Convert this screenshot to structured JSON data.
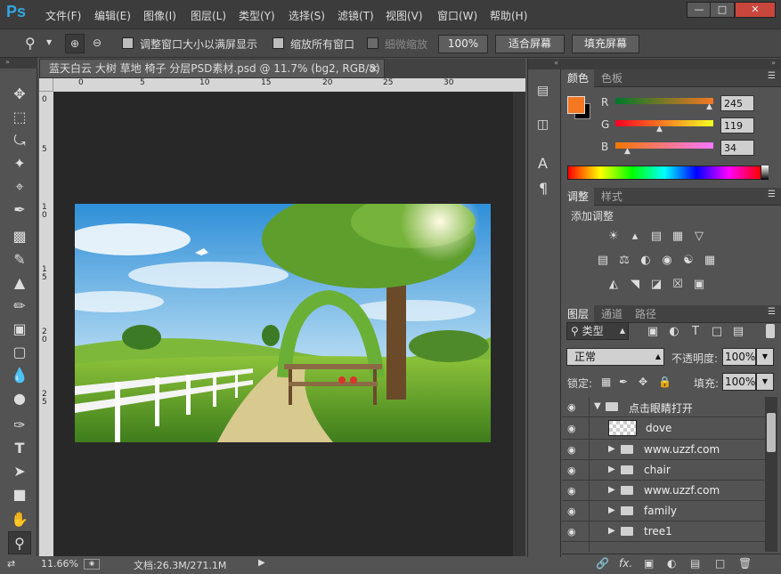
{
  "menubar": {
    "logo": "Ps",
    "items": [
      "文件(F)",
      "编辑(E)",
      "图像(I)",
      "图层(L)",
      "类型(Y)",
      "选择(S)",
      "滤镜(T)",
      "视图(V)",
      "窗口(W)",
      "帮助(H)"
    ],
    "window_buttons": [
      "—",
      "□",
      "✕"
    ]
  },
  "options": {
    "resize_windows_label": "调整窗口大小以满屏显示",
    "zoom_all_label": "缩放所有窗口",
    "scrubby_label": "细微缩放",
    "btn_100": "100%",
    "btn_fit": "适合屏幕",
    "btn_fill": "填充屏幕"
  },
  "document": {
    "tab_title": "蓝天白云 大树 草地 椅子 分层PSD素材.psd @ 11.7% (bg2, RGB/8)",
    "tab_close": "×",
    "ruler_h": [
      "0",
      "5",
      "10",
      "15",
      "20",
      "25",
      "30"
    ],
    "ruler_v": [
      "0",
      "5",
      "1\n0",
      "1\n5",
      "2\n0",
      "2\n5"
    ]
  },
  "status": {
    "zoom": "11.66%",
    "doc_info": "文档:26.3M/271.1M",
    "arrow": "▶"
  },
  "color_panel": {
    "tabs": [
      "颜色",
      "色板"
    ],
    "r_label": "R",
    "r_value": "245",
    "g_label": "G",
    "g_value": "119",
    "b_label": "B",
    "b_value": "34",
    "fg_color": "#f57722",
    "bg_color": "#000000"
  },
  "adjust_panel": {
    "tabs": [
      "调整",
      "样式"
    ],
    "title": "添加调整"
  },
  "layers_panel": {
    "tabs": [
      "图层",
      "通道",
      "路径"
    ],
    "filter_label": "类型",
    "blend_mode": "正常",
    "opacity_label": "不透明度:",
    "opacity_value": "100%",
    "lock_label": "锁定:",
    "fill_label": "填充:",
    "fill_value": "100%",
    "layers": [
      {
        "name": "点击眼睛打开",
        "type": "group-open"
      },
      {
        "name": "dove",
        "type": "layer"
      },
      {
        "name": "www.uzzf.com",
        "type": "group"
      },
      {
        "name": "chair",
        "type": "group"
      },
      {
        "name": "www.uzzf.com",
        "type": "group"
      },
      {
        "name": "family",
        "type": "group"
      },
      {
        "name": "tree1",
        "type": "group"
      }
    ],
    "footer_icons": [
      "link-icon",
      "fx-icon",
      "mask-icon",
      "adjustment-icon",
      "folder-icon",
      "new-layer-icon",
      "trash-icon"
    ]
  }
}
